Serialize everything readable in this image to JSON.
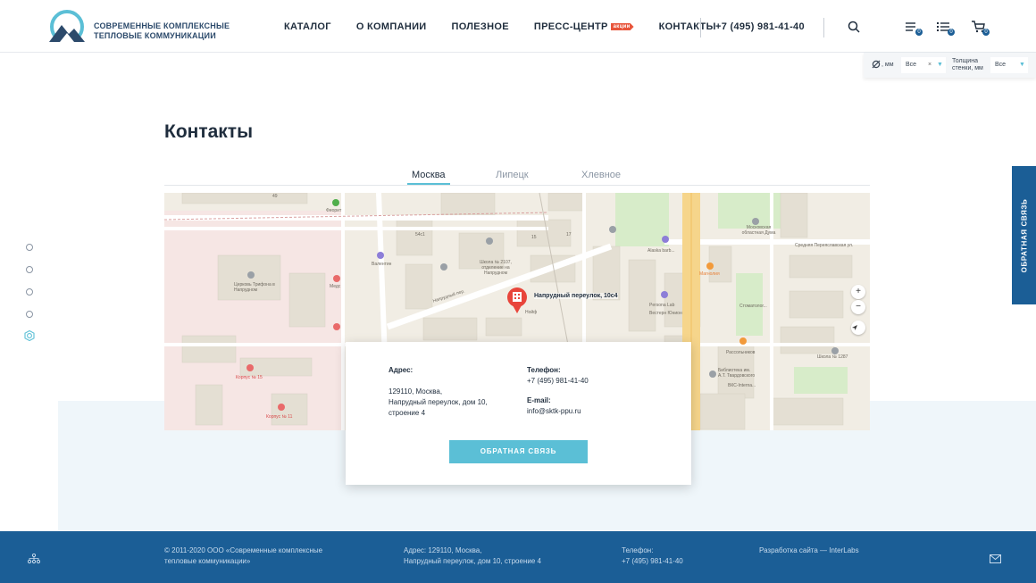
{
  "brand": {
    "name_line1": "СОВРЕМЕННЫЕ КОМПЛЕКСНЫЕ",
    "name_line2": "ТЕПЛОВЫЕ КОММУНИКАЦИИ",
    "logo_icon": "mountain-logo-icon",
    "accent": "#5bbfd6",
    "primary": "#1b5e96"
  },
  "nav": {
    "items": [
      "КАТАЛОГ",
      "О КОМПАНИИ",
      "ПОЛЕЗНОЕ",
      "ПРЕСС-ЦЕНТР",
      "КОНТАКТЫ"
    ],
    "promo_badge": "акции",
    "phone": "+7 (495) 981-41-40"
  },
  "header_icons": {
    "search": "search-icon",
    "compare": {
      "icon": "compare-list-icon",
      "count": "0"
    },
    "favorites": {
      "icon": "list-icon",
      "count": "0"
    },
    "cart": {
      "icon": "cart-icon",
      "count": "0"
    }
  },
  "filter": {
    "diameter_label": ", мм",
    "diameter_value": "Все",
    "thickness_label_1": "Толщина",
    "thickness_label_2": "стенки, мм",
    "thickness_value": "Все"
  },
  "page": {
    "title": "Контакты",
    "tabs": [
      "Москва",
      "Липецк",
      "Хлевное"
    ],
    "active_tab": "Москва"
  },
  "map": {
    "pin_label": "Напрудный переулок, 10с4",
    "labels": {
      "l1": "49",
      "l2": "Фиорит",
      "l3": "Валентин",
      "l4": "Церковь Трифона в Напрудном",
      "l5": "Медс",
      "l6": "54с1",
      "l7": "Школа № 2107, отделение на Напрудном",
      "l8": "15",
      "l9": "17",
      "l10": "Напрудный пер.",
      "l11": "Alaska barb...",
      "l12": "Persona Lab",
      "l13": "Вестерн Юнион",
      "l14": "Магнолия",
      "l15": "Московская областная Дума",
      "l16": "Средняя Переяславская ул.",
      "l17": "Стоматолог...",
      "l18": "Рассольников",
      "l19": "ВКС-Interna...",
      "l20": "Школа № 1287",
      "l21": "Корпус № 15",
      "l22": "Корпус № 11",
      "l23": "Нойф",
      "l24": "Библиотека им. А.Т. Твардовского"
    },
    "zoom_in": "+",
    "zoom_out": "−"
  },
  "card": {
    "address_label": "Адрес:",
    "address_line1": "129110, Москва,",
    "address_line2": "Напрудный переулок, дом 10,",
    "address_line3": "строение 4",
    "phone_label": "Телефон:",
    "phone": "+7 (495) 981-41-40",
    "email_label": "E-mail:",
    "email": "info@sktk-ppu.ru",
    "button": "ОБРАТНАЯ СВЯЗЬ"
  },
  "side_feedback": "ОБРАТНАЯ СВЯЗЬ",
  "footer": {
    "copyright_1": "© 2011-2020 ООО «Современные комплексные",
    "copyright_2": "тепловые коммуникации»",
    "address_1": "Адрес: 129110, Москва,",
    "address_2": "Напрудный переулок, дом 10, строение 4",
    "phone_label": "Телефон:",
    "phone": "+7 (495) 981-41-40",
    "dev": "Разработка сайта — InterLabs",
    "sitemap_icon": "sitemap-icon",
    "mail_icon": "mail-icon"
  }
}
